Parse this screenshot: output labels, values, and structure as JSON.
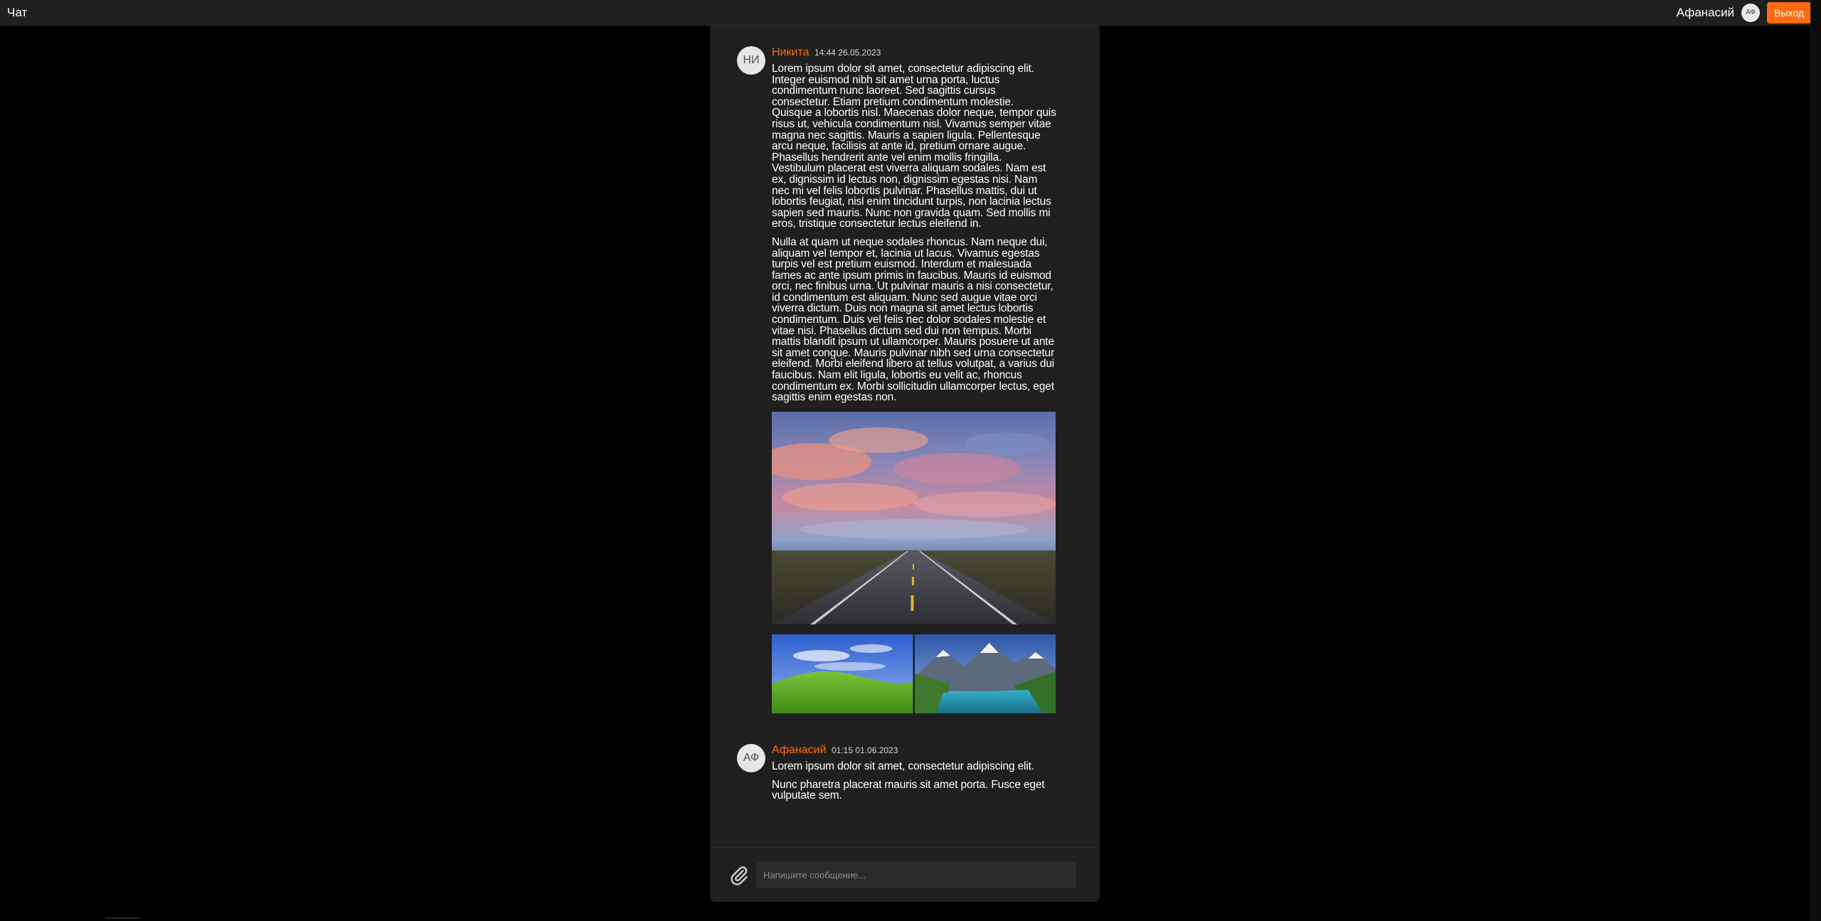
{
  "header": {
    "title": "Чат",
    "username": "Афанасий",
    "avatar_initials": "АФ",
    "logout_label": "Выход"
  },
  "colors": {
    "accent": "#ff6a13",
    "panel_bg": "#1f1f1f",
    "page_bg": "#000000",
    "input_bg": "#2b2b2b"
  },
  "messages": [
    {
      "avatar_initials": "НИ",
      "author": "Никита",
      "time": "14:44 26.05.2023",
      "paragraphs": [
        "Lorem ipsum dolor sit amet, consectetur adipiscing elit. Integer euismod nibh sit amet urna porta, luctus condimentum nunc laoreet. Sed sagittis cursus consectetur. Etiam pretium condimentum molestie. Quisque a lobortis nisl. Maecenas dolor neque, tempor quis risus ut, vehicula condimentum nisl. Vivamus semper vitae magna nec sagittis. Mauris a sapien ligula. Pellentesque arcu neque, facilisis at ante id, pretium ornare augue. Phasellus hendrerit ante vel enim mollis fringilla. Vestibulum placerat est viverra aliquam sodales. Nam est ex, dignissim id lectus non, dignissim egestas nisi. Nam nec mi vel felis lobortis pulvinar. Phasellus mattis, dui ut lobortis feugiat, nisl enim tincidunt turpis, non lacinia lectus sapien sed mauris. Nunc non gravida quam. Sed mollis mi eros, tristique consectetur lectus eleifend in.",
        "Nulla at quam ut neque sodales rhoncus. Nam neque dui, aliquam vel tempor et, lacinia ut lacus. Vivamus egestas turpis vel est pretium euismod. Interdum et malesuada fames ac ante ipsum primis in faucibus. Mauris id euismod orci, nec finibus urna. Ut pulvinar mauris a nisi consectetur, id condimentum est aliquam. Nunc sed augue vitae orci viverra dictum. Duis non magna sit amet lectus lobortis condimentum. Duis vel felis nec dolor sodales molestie et vitae nisi. Phasellus dictum sed dui non tempus. Morbi mattis blandit ipsum ut ullamcorper. Mauris posuere ut ante sit amet congue. Mauris pulvinar nibh sed urna consectetur eleifend. Morbi eleifend libero at tellus volutpat, a varius dui faucibus. Nam elit ligula, lobortis eu velit ac, rhoncus condimentum ex. Morbi sollicitudin ullamcorper lectus, eget sagittis enim egestas non."
      ],
      "images": [
        "road-sunset-photo",
        "green-hills-photo",
        "mountain-lake-photo"
      ]
    },
    {
      "avatar_initials": "АФ",
      "author": "Афанасий",
      "time": "01:15 01.06.2023",
      "paragraphs": [
        "Lorem ipsum dolor sit amet, consectetur adipiscing elit.",
        "Nunc pharetra placerat mauris sit amet porta. Fusce eget vulputate sem."
      ]
    }
  ],
  "composer": {
    "placeholder": "Напишите сообщение...",
    "attach_icon": "paperclip-icon"
  }
}
